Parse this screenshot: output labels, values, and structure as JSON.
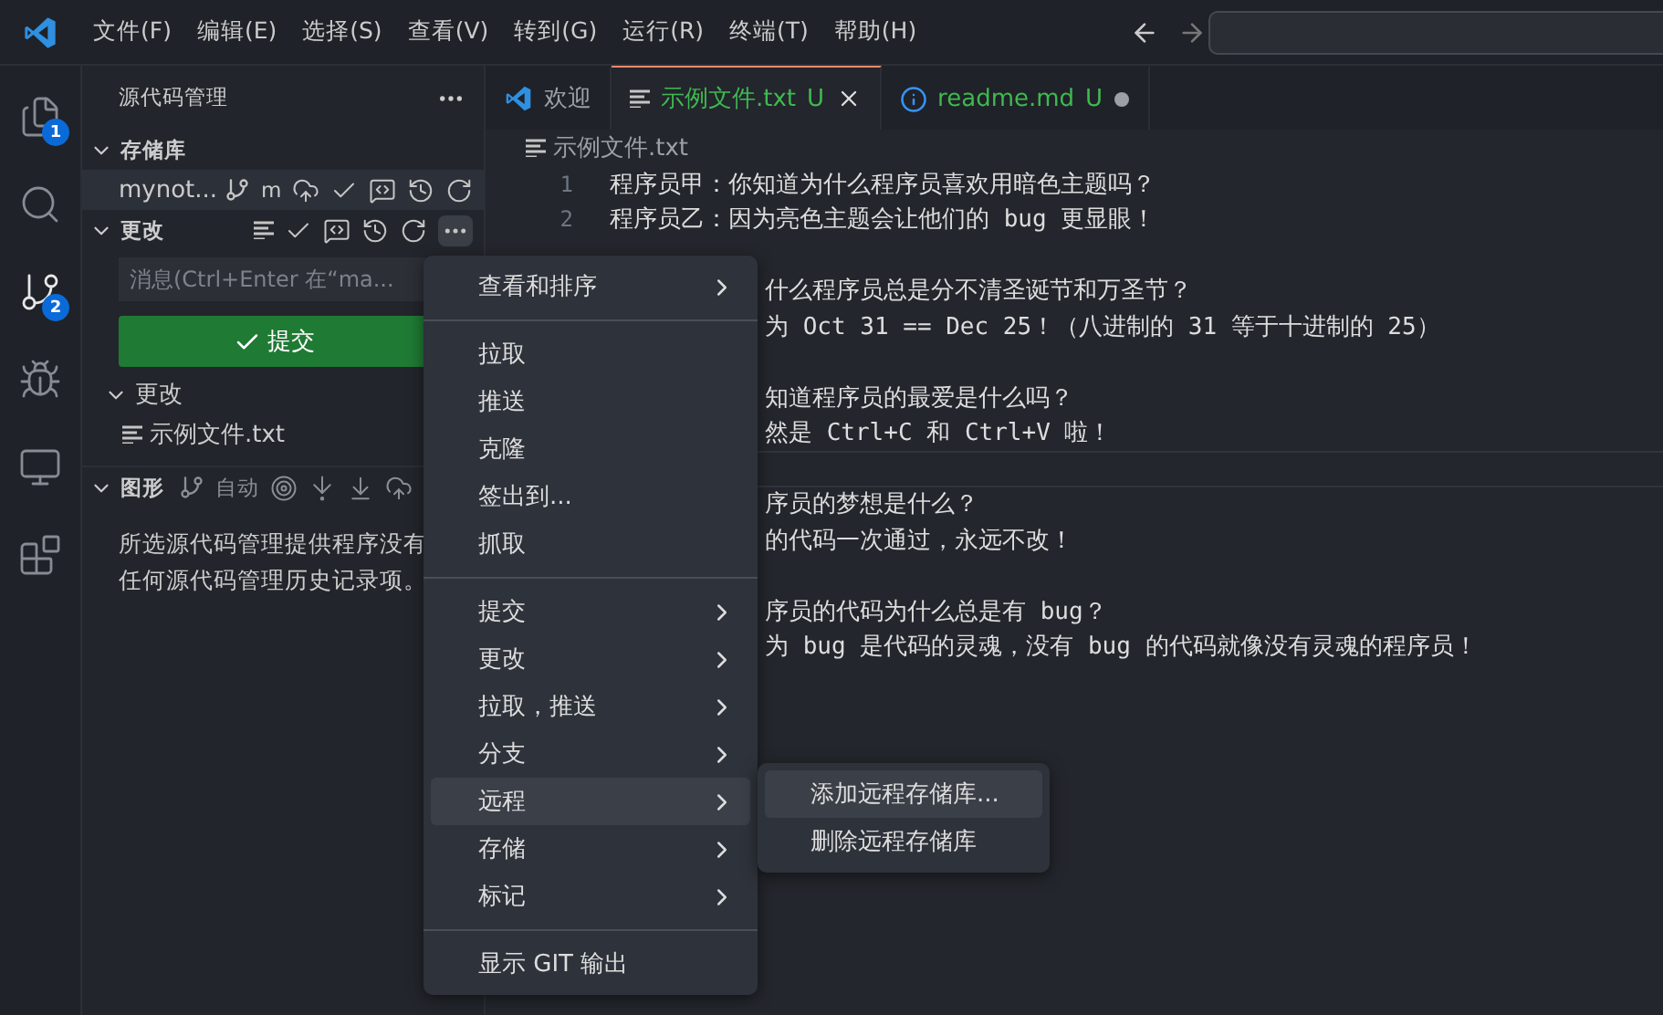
{
  "menubar": [
    "文件(F)",
    "编辑(E)",
    "选择(S)",
    "查看(V)",
    "转到(G)",
    "运行(R)",
    "终端(T)",
    "帮助(H)"
  ],
  "activity": [
    {
      "badge": "1",
      "selected": false
    },
    {
      "selected": false
    },
    {
      "badge": "2",
      "selected": true
    },
    {
      "selected": false
    },
    {
      "selected": false
    },
    {
      "selected": false
    }
  ],
  "sidebar": {
    "title": "源代码管理",
    "repos_section": "存储库",
    "repo": {
      "name": "mynot...",
      "branch": "m"
    },
    "changes_section": "更改",
    "message": {
      "placeholder": "消息(Ctrl+Enter 在“ma..."
    },
    "commit": "提交",
    "group": "更改",
    "files": [
      "示例文件.txt"
    ],
    "graph": {
      "title": "图形",
      "mode": "自动",
      "empty": "所选源代码管理提供程序没有任何源代码管理历史记录项。"
    }
  },
  "tabs": [
    {
      "label": "欢迎",
      "selected": false,
      "dirty": false
    },
    {
      "label": "示例文件.txt",
      "selected": true,
      "status": "U",
      "dirty": false
    },
    {
      "label": "readme.md",
      "selected": false,
      "status": "U",
      "dirty": true
    }
  ],
  "breadcrumb": "示例文件.txt",
  "lines": [
    {
      "number": "1",
      "text": "程序员甲：你知道为什么程序员喜欢用暗色主题吗？",
      "current": false
    },
    {
      "number": "2",
      "text": "程序员乙：因为亮色主题会让他们的 bug 更显眼！",
      "current": false
    }
  ],
  "covered_lines": [
    {
      "current": false
    },
    {
      "text": "什么程序员总是分不清圣诞节和万圣节？",
      "current": false
    },
    {
      "text": "为 Oct 31 == Dec 25！（八进制的 31 等于十进制的 25）",
      "current": false
    },
    {
      "current": false
    },
    {
      "text": "知道程序员的最爱是什么吗？",
      "current": false
    },
    {
      "text": "然是 Ctrl+C 和 Ctrl+V 啦！",
      "current": false
    },
    {
      "current": true
    },
    {
      "text": "序员的梦想是什么？",
      "current": false
    },
    {
      "text": "的代码一次通过，永远不改！",
      "current": false
    },
    {
      "current": false
    },
    {
      "text": "序员的代码为什么总是有 bug？",
      "current": false
    },
    {
      "text": "为 bug 是代码的灵魂，没有 bug 的代码就像没有灵魂的程序员！",
      "current": false
    }
  ],
  "menu": [
    {
      "kind": "sub",
      "label": "查看和排序",
      "selected": false
    },
    {
      "kind": "separator"
    },
    {
      "kind": "item",
      "label": "拉取",
      "selected": false
    },
    {
      "kind": "item",
      "label": "推送",
      "selected": false
    },
    {
      "kind": "item",
      "label": "克隆",
      "selected": false
    },
    {
      "kind": "item",
      "label": "签出到...",
      "selected": false
    },
    {
      "kind": "item",
      "label": "抓取",
      "selected": false
    },
    {
      "kind": "separator"
    },
    {
      "kind": "sub",
      "label": "提交",
      "selected": false
    },
    {
      "kind": "sub",
      "label": "更改",
      "selected": false
    },
    {
      "kind": "sub",
      "label": "拉取，推送",
      "selected": false
    },
    {
      "kind": "sub",
      "label": "分支",
      "selected": false
    },
    {
      "kind": "sub",
      "label": "远程",
      "selected": true
    },
    {
      "kind": "sub",
      "label": "存储",
      "selected": false
    },
    {
      "kind": "sub",
      "label": "标记",
      "selected": false
    },
    {
      "kind": "separator"
    },
    {
      "kind": "item",
      "label": "显示 GIT 输出",
      "selected": false
    }
  ],
  "submenu": [
    {
      "label": "添加远程存储库...",
      "selected": true
    },
    {
      "label": "删除远程存储库",
      "selected": false
    }
  ]
}
